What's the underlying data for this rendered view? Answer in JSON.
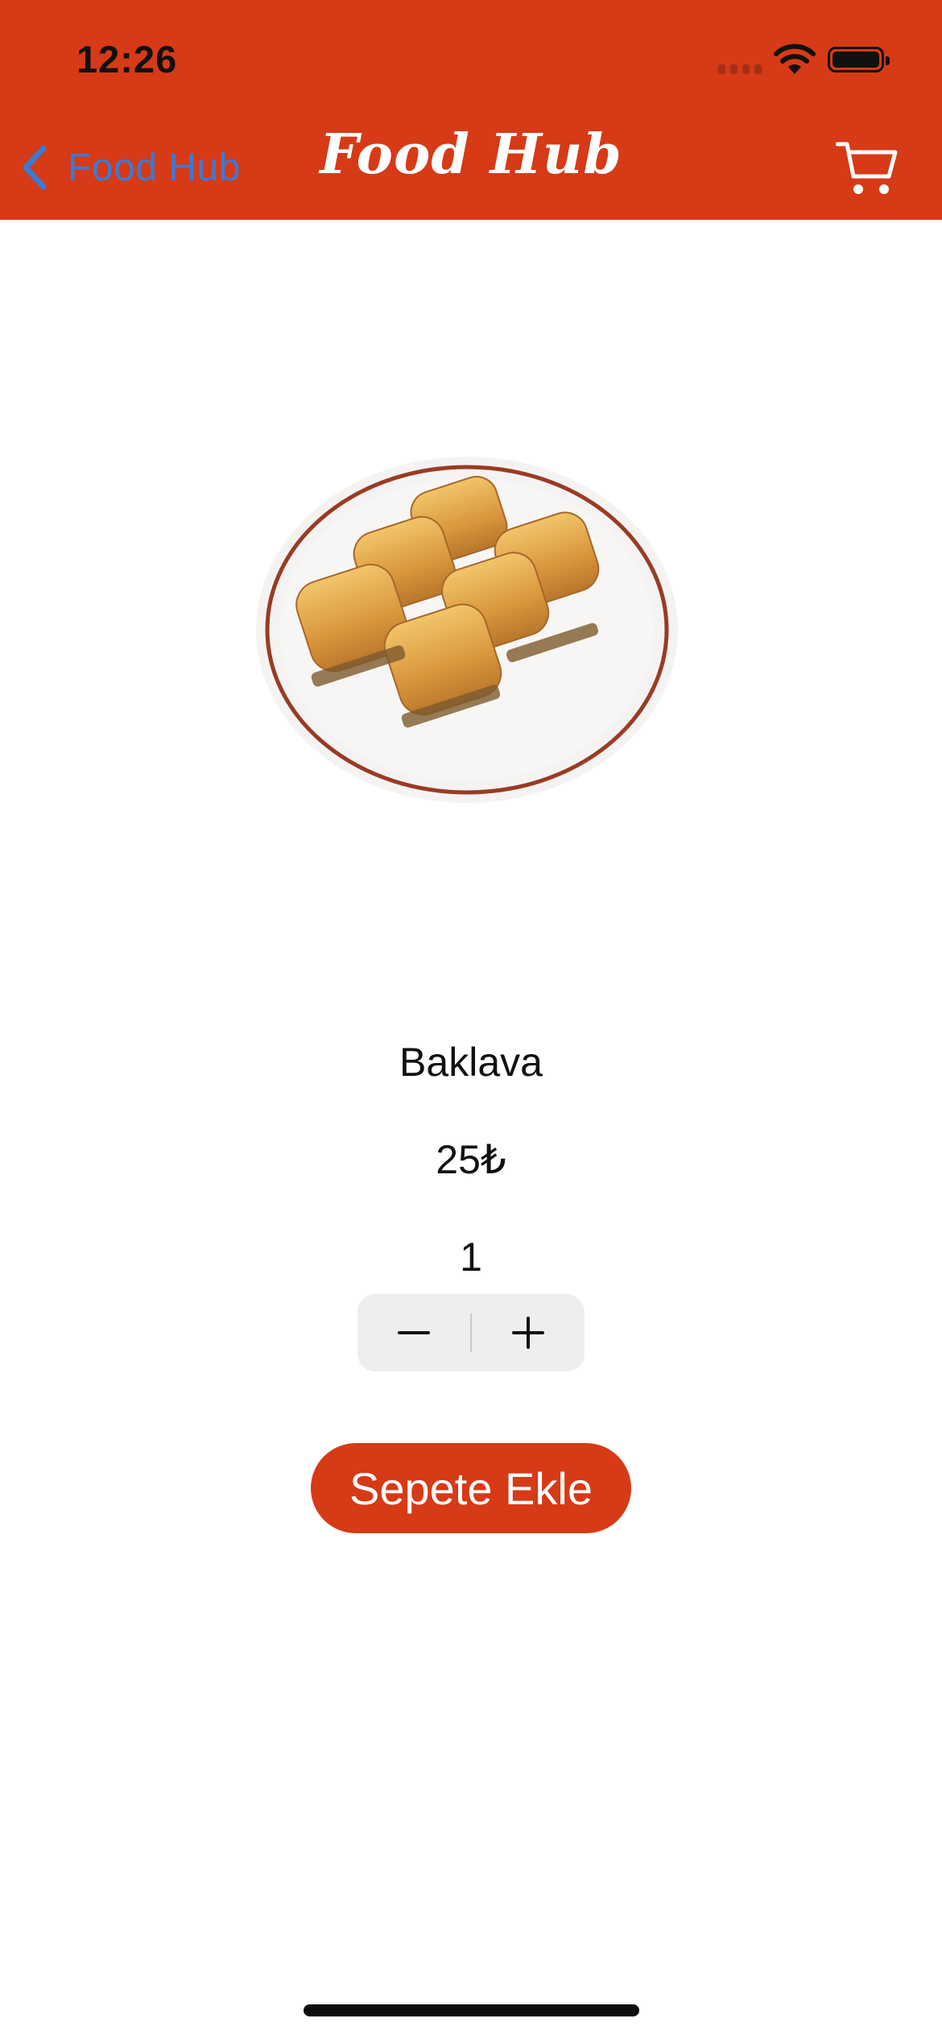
{
  "colors": {
    "brand": "#d63a17",
    "back_link": "#3a7bd5"
  },
  "status_bar": {
    "time": "12:26",
    "icons": [
      "signal-icon",
      "wifi-icon",
      "battery-icon"
    ]
  },
  "nav": {
    "back_label": "Food Hub",
    "title": "Food Hub",
    "cart_icon": "cart-icon"
  },
  "product": {
    "image_icon": "baklava-plate-image",
    "name": "Baklava",
    "price": "25₺",
    "quantity": "1"
  },
  "stepper": {
    "minus_icon": "minus-icon",
    "plus_icon": "plus-icon"
  },
  "actions": {
    "add_to_cart_label": "Sepete Ekle"
  }
}
